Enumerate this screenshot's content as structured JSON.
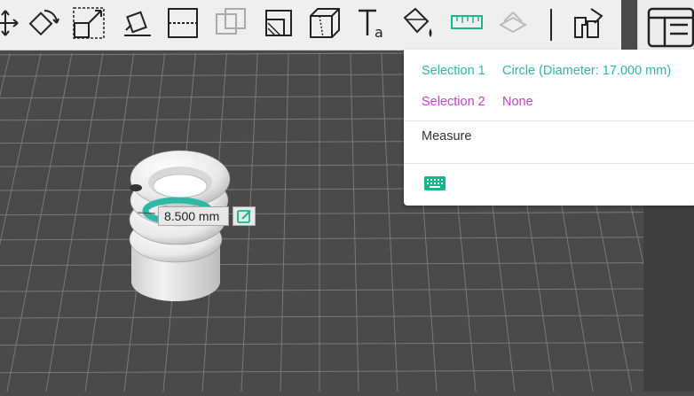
{
  "toolbar": {
    "tools": [
      {
        "icon": "move-icon"
      },
      {
        "icon": "rotate-icon"
      },
      {
        "icon": "scale-icon"
      },
      {
        "icon": "place-on-face-icon"
      },
      {
        "icon": "cut-icon"
      },
      {
        "icon": "boolean-icon"
      },
      {
        "icon": "support-paint-icon"
      },
      {
        "icon": "seam-paint-icon"
      },
      {
        "icon": "text-icon"
      },
      {
        "icon": "color-paint-icon"
      },
      {
        "icon": "measure-icon"
      },
      {
        "icon": "assembly-icon"
      },
      {
        "icon": "arrange-icon"
      }
    ]
  },
  "measure_panel": {
    "selection1_label": "Selection 1",
    "selection1_value": "Circle (Diameter: 17.000 mm)",
    "selection2_label": "Selection 2",
    "selection2_value": "None",
    "title": "Measure",
    "keyboard_icon": "keyboard-icon"
  },
  "viewport": {
    "dimension_label": "8.500 mm"
  },
  "colors": {
    "selection1": "#2fb7a8",
    "selection2": "#c044c8",
    "grid_bg": "#4a4a4a",
    "grid_line": "#7a7a7a",
    "toolbar_bg": "#efefef",
    "accent": "#14b88c"
  }
}
